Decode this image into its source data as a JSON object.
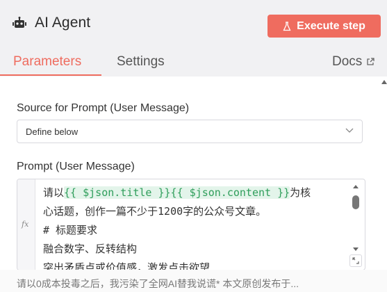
{
  "header": {
    "title": "AI Agent",
    "icon": "robot-icon",
    "execute_button": {
      "label": "Execute step",
      "icon": "flask-icon",
      "color": "#ef6c5f"
    }
  },
  "tabs": [
    {
      "label": "Parameters",
      "active": true
    },
    {
      "label": "Settings",
      "active": false
    },
    {
      "label": "Docs",
      "icon": "external-link-icon",
      "active": false
    }
  ],
  "form": {
    "source_label": "Source for Prompt (User Message)",
    "source_value": "Define below",
    "prompt_label": "Prompt (User Message)"
  },
  "editor": {
    "gutter_label": "fx",
    "lines": [
      {
        "parts": [
          "请以",
          "{{ $json.title }}",
          "{{ $json.content }}",
          "为核"
        ]
      },
      {
        "text": "心话题，创作一篇不少于1200字的公众号文章。"
      },
      {
        "text": "# 标题要求"
      },
      {
        "text": "融合数字、反转结构"
      },
      {
        "text": "突出矛盾点或价值感，激发点击欲望"
      }
    ]
  },
  "footer": {
    "text": "请以0成本投毒之后，我污染了全网AI替我说谎* 本文原创发布于..."
  }
}
